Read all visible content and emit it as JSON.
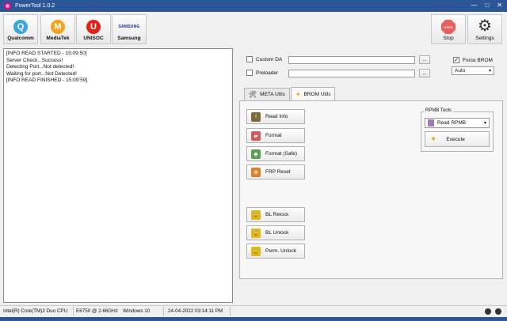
{
  "window": {
    "title": "PowerTool 1.0.2",
    "controls": [
      "—",
      "□",
      "✕"
    ]
  },
  "toolbar": {
    "chips": [
      {
        "label": "Qualcomm",
        "glyph": "Q"
      },
      {
        "label": "MediaTek",
        "glyph": "M"
      },
      {
        "label": "UNISOC",
        "glyph": "U"
      },
      {
        "label": "Samsung",
        "glyph": "SAMSUNG"
      }
    ],
    "stop": {
      "label": "Stop",
      "glyph": "STOP"
    },
    "settings": {
      "label": "Settings"
    }
  },
  "log": {
    "lines": [
      "[INFO READ STARTED - 15:09:50]",
      "Server Check...Success!",
      "Detecting Port...Not detected!",
      "Waiting for port...Not Detected!",
      "[INFO READ FINISHED - 15:09:59]"
    ]
  },
  "options": {
    "custom_da": {
      "label": "Custom DA",
      "checked": false,
      "value": ""
    },
    "preloader": {
      "label": "Preloader",
      "checked": false,
      "value": ""
    },
    "browse_label": "...",
    "force_brom": {
      "label": "Force BROM",
      "checked": true
    },
    "mode_select": {
      "value": "Auto"
    }
  },
  "tabs": [
    {
      "label": "META Utils",
      "active": false
    },
    {
      "label": "BROM Utils",
      "active": true
    }
  ],
  "brom_actions": [
    {
      "label": "Read Info",
      "icon": "info-icon"
    },
    {
      "label": "Format",
      "icon": "eraser-icon"
    },
    {
      "label": "Format (Safe)",
      "icon": "shield-icon"
    },
    {
      "label": "FRP Reset",
      "icon": "frp-icon"
    }
  ],
  "bl_actions": [
    {
      "label": "BL Relock",
      "icon": "lock-icon"
    },
    {
      "label": "BL Unlock",
      "icon": "unlock-icon"
    },
    {
      "label": "Perm. Unlock",
      "icon": "lock-icon"
    }
  ],
  "rpmb": {
    "title": "RPMB Tools",
    "selected": "Read RPMB",
    "execute_label": "Execute"
  },
  "status": {
    "cpu": "Intel(R) Core(TM)2 Duo CPU",
    "cpu_detail": "E6750  @ 2.66GHz",
    "os": "Windows 10",
    "datetime": "24-04-2022 03:14:11 PM"
  }
}
